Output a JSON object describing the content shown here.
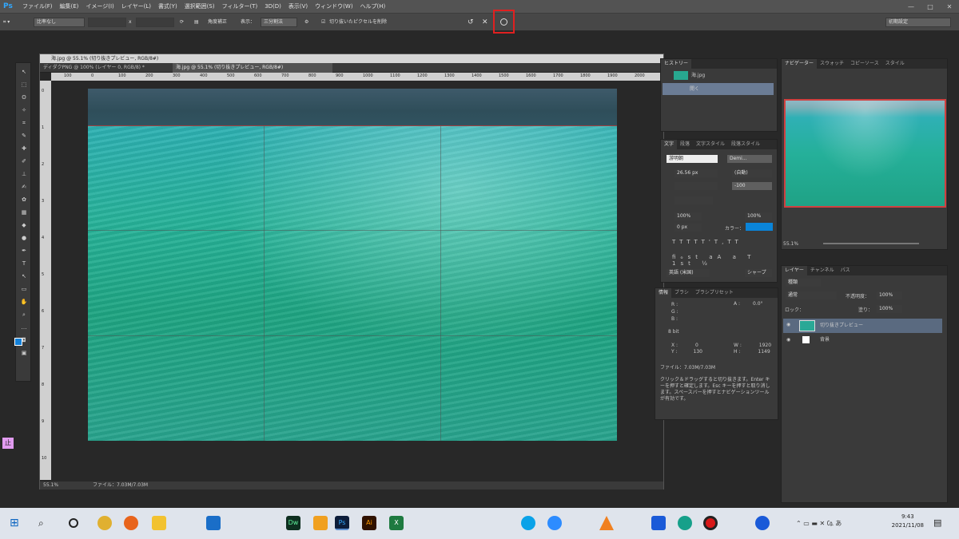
{
  "menu": {
    "logo": "Ps",
    "items": [
      "ファイル(F)",
      "編集(E)",
      "イメージ(I)",
      "レイヤー(L)",
      "書式(Y)",
      "選択範囲(S)",
      "フィルター(T)",
      "3D(D)",
      "表示(V)",
      "ウィンドウ(W)",
      "ヘルプ(H)"
    ]
  },
  "options": {
    "ratio": "比率なし",
    "x": "x",
    "straighten": "角度補正",
    "view_label": "表示：",
    "view_value": "三分割法",
    "delete_cropped": "切り抜いたピクセルを削除",
    "workspace": "初期設定"
  },
  "document": {
    "title": "海.jpg @ 55.1% (切り抜きプレビュー, RGB/8#)",
    "tabs": [
      "ディダクPNG @ 100% (レイヤー 0, RGB/8) *",
      "海.jpg @ 55.1% (切り抜きプレビュー, RGB/8#)"
    ],
    "ruler_h": [
      "100",
      "0",
      "100",
      "200",
      "300",
      "400",
      "500",
      "600",
      "700",
      "800",
      "900",
      "1000",
      "1100",
      "1200",
      "1300",
      "1400",
      "1500",
      "1600",
      "1700",
      "1800",
      "1900",
      "2000"
    ],
    "ruler_v": [
      "0",
      "1",
      "2",
      "3",
      "4",
      "5",
      "6",
      "7",
      "8",
      "9",
      "10"
    ],
    "zoom": "55.1%",
    "file": "ファイル：7.03M/7.03M"
  },
  "history": {
    "tab": "ヒストリー",
    "items": [
      "海.jpg",
      "開く"
    ]
  },
  "character": {
    "tabs": [
      "文字",
      "段落",
      "文字スタイル",
      "段落スタイル"
    ],
    "font": "游明朝",
    "style": "Demi...",
    "size": "26.56 px",
    "leading": "(自動)",
    "tracking": "-100",
    "scale_v": "100%",
    "scale_h": "100%",
    "baseline": "0 px",
    "color_label": "カラー：",
    "lang": "英語 (米国)",
    "aa": "シャープ"
  },
  "info": {
    "tabs": [
      "情報",
      "ブラシ",
      "ブラシプリセット"
    ],
    "rgb": [
      "R :",
      "G :",
      "B :"
    ],
    "angle_label": "A :",
    "angle": "0.0°",
    "bits": "8 bit",
    "x_label": "X :",
    "x": "0",
    "y_label": "Y :",
    "y": "130",
    "w_label": "W :",
    "w": "1920",
    "h_label": "H :",
    "h": "1149",
    "file": "ファイル：7.03M/7.03M",
    "hint": "クリック＆ドラッグすると切り抜きます。Enter キーを押すと確定します。Esc キーを押すと取り消します。スペースバーを押すとナビゲーションツールが有効です。"
  },
  "navigator": {
    "tabs": [
      "ナビゲーター",
      "スウォッチ",
      "コピーソース",
      "スタイル"
    ],
    "zoom": "55.1%"
  },
  "layers": {
    "tabs": [
      "レイヤー",
      "チャンネル",
      "パス"
    ],
    "kind": "種類",
    "blend": "通常",
    "opacity_label": "不透明度：",
    "opacity": "100%",
    "lock_label": "ロック：",
    "fill_label": "塗り：",
    "fill": "100%",
    "items": [
      "切り抜きプレビュー",
      "背景"
    ]
  },
  "taskbar": {
    "time": "9:43",
    "date": "2021/11/08",
    "icons": [
      "Dw",
      "Ps",
      "Ai",
      "X"
    ]
  },
  "side_badge": "止"
}
